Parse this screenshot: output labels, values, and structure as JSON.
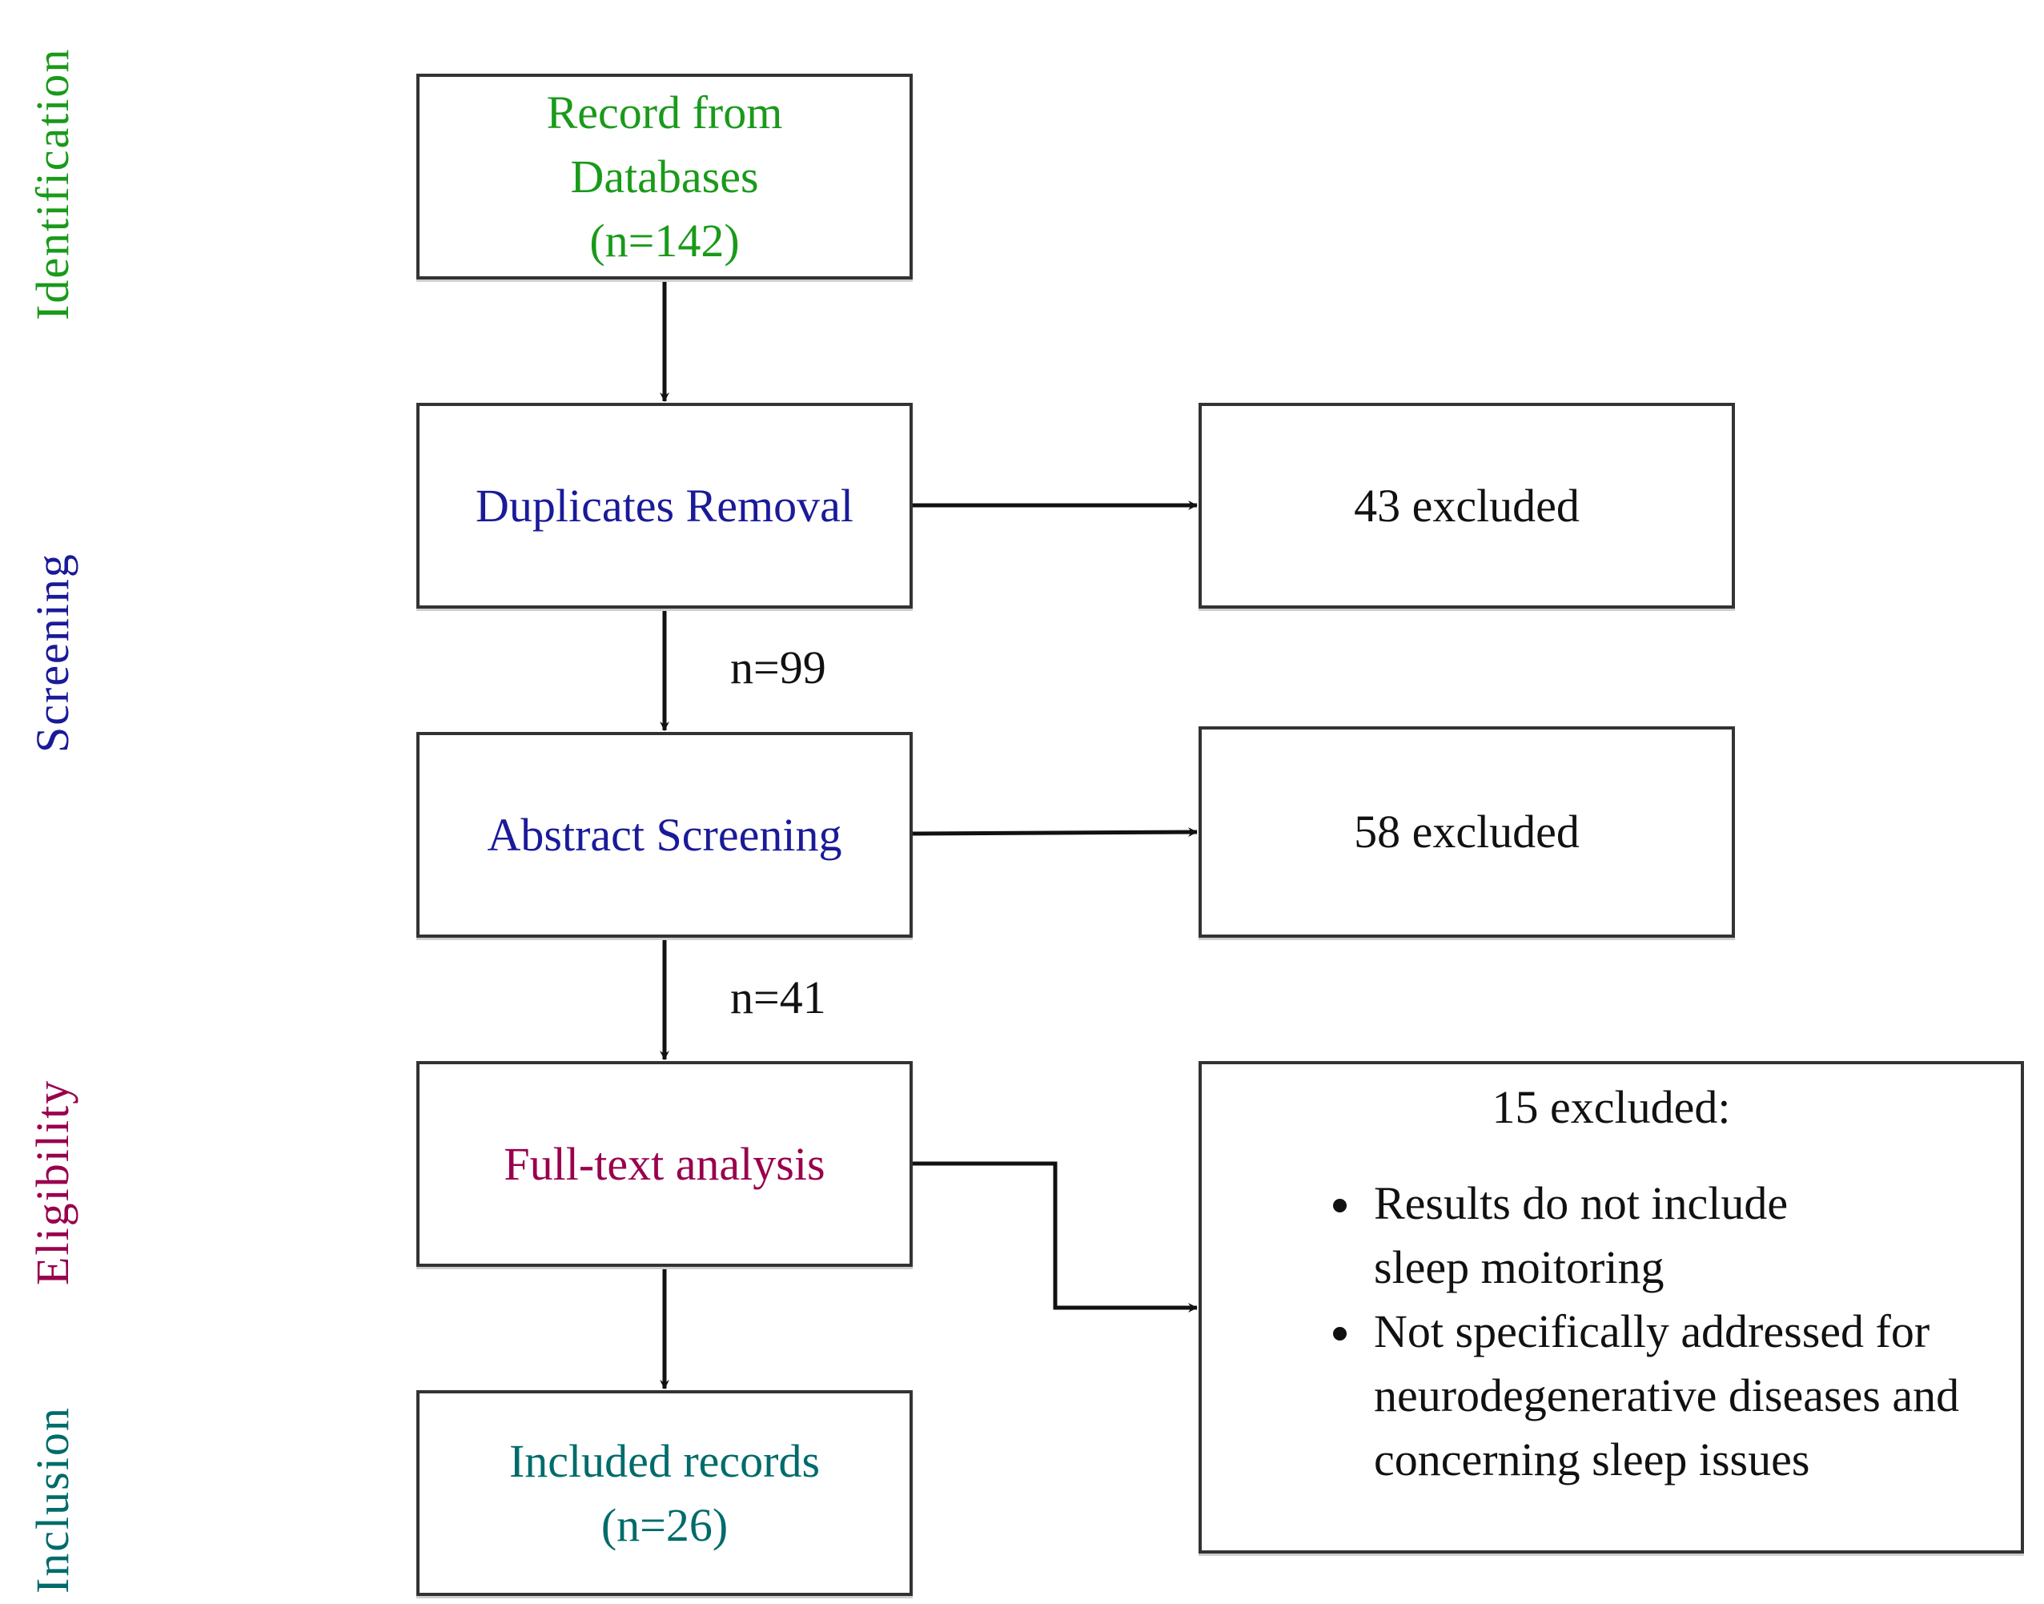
{
  "colors": {
    "identification": "#1a9a1a",
    "screening": "#1a1a99",
    "eligibility": "#99004d",
    "inclusion": "#006b6b",
    "neutral": "#111111",
    "stroke": "#111111"
  },
  "stages": {
    "identification": "Identification",
    "screening": "Screening",
    "eligibility": "Eligibility",
    "inclusion": "Inclusion"
  },
  "boxes": {
    "records": {
      "line1": "Record from",
      "line2": "Databases",
      "line3": "(n=142)"
    },
    "duplicates": {
      "line1": "Duplicates Removal"
    },
    "abstract": {
      "line1": "Abstract Screening"
    },
    "fulltext": {
      "line1": "Full-text analysis"
    },
    "included": {
      "line1": "Included records",
      "line2": "(n=26)"
    }
  },
  "flow_counts": {
    "after_duplicates": "n=99",
    "after_abstract": "n=41"
  },
  "exclusions": {
    "duplicates": "43 excluded",
    "abstract": "58 excluded",
    "fulltext": {
      "title": "15 excluded:",
      "reasons": [
        "Results do not include sleep moitoring",
        "Not specifically addressed for neurodegenerative diseases and concerning sleep issues"
      ]
    }
  }
}
